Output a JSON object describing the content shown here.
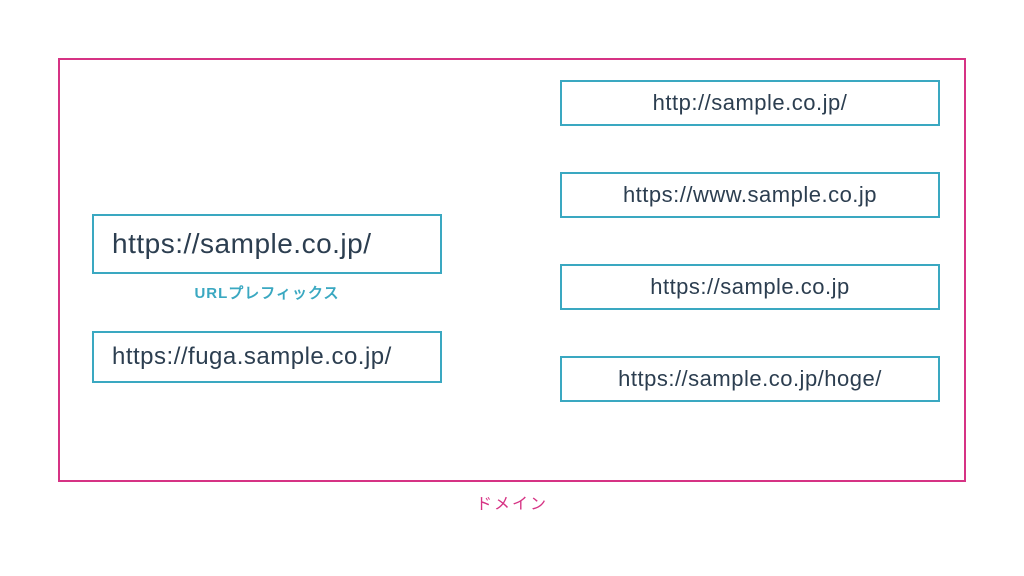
{
  "domain": {
    "label": "ドメイン"
  },
  "left": {
    "primary_url": "https://sample.co.jp/",
    "prefix_label": "URLプレフィックス",
    "secondary_url": "https://fuga.sample.co.jp/"
  },
  "right": {
    "urls": [
      "http://sample.co.jp/",
      "https://www.sample.co.jp",
      "https://sample.co.jp",
      "https://sample.co.jp/hoge/"
    ]
  },
  "colors": {
    "teal": "#3aa8c1",
    "pink": "#d63384",
    "text": "#2c3e50"
  }
}
